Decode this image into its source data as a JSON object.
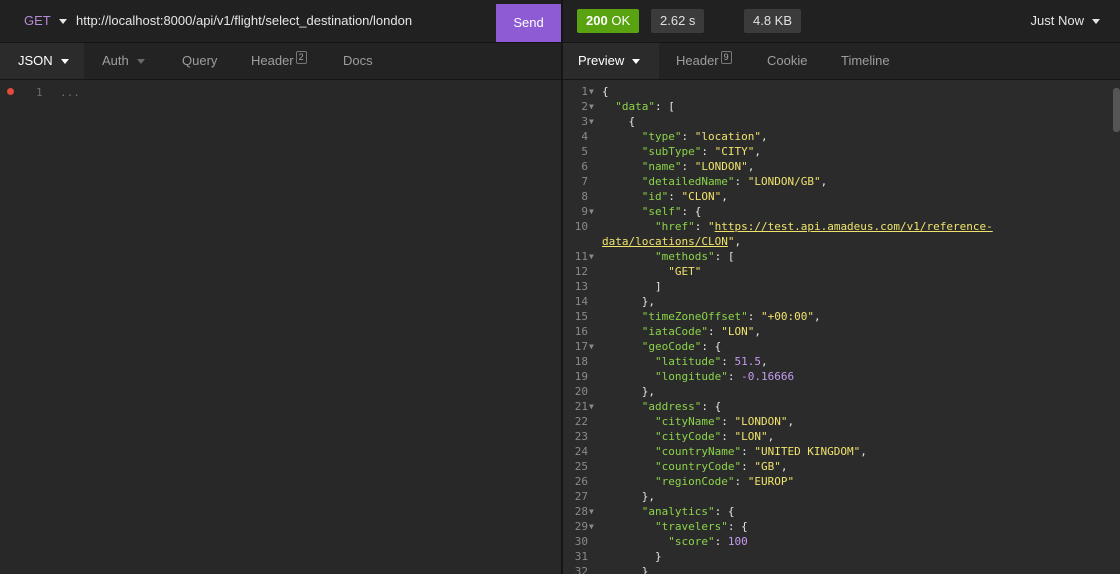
{
  "request": {
    "method": "GET",
    "url": "http://localhost:8000/api/v1/flight/select_destination/london",
    "send_label": "Send",
    "tabs": {
      "json": "JSON",
      "auth": "Auth",
      "query": "Query",
      "header": "Header",
      "header_count": "2",
      "docs": "Docs"
    },
    "editor": {
      "line_number": "1",
      "placeholder": "..."
    }
  },
  "response": {
    "status_code": "200",
    "status_text": "OK",
    "time": "2.62 s",
    "size": "4.8 KB",
    "history_label": "Just Now",
    "tabs": {
      "preview": "Preview",
      "header": "Header",
      "header_count": "9",
      "cookie": "Cookie",
      "timeline": "Timeline"
    },
    "gutter": [
      {
        "n": "1",
        "fold": true
      },
      {
        "n": "2",
        "fold": true
      },
      {
        "n": "3",
        "fold": true
      },
      {
        "n": "4"
      },
      {
        "n": "5"
      },
      {
        "n": "6"
      },
      {
        "n": "7"
      },
      {
        "n": "8"
      },
      {
        "n": "9",
        "fold": true
      },
      {
        "n": "10"
      },
      {
        "n": ""
      },
      {
        "n": "11",
        "fold": true
      },
      {
        "n": "12"
      },
      {
        "n": "13"
      },
      {
        "n": "14"
      },
      {
        "n": "15"
      },
      {
        "n": "16"
      },
      {
        "n": "17",
        "fold": true
      },
      {
        "n": "18"
      },
      {
        "n": "19"
      },
      {
        "n": "20"
      },
      {
        "n": "21",
        "fold": true
      },
      {
        "n": "22"
      },
      {
        "n": "23"
      },
      {
        "n": "24"
      },
      {
        "n": "25"
      },
      {
        "n": "26"
      },
      {
        "n": "27"
      },
      {
        "n": "28",
        "fold": true
      },
      {
        "n": "29",
        "fold": true
      },
      {
        "n": "30"
      },
      {
        "n": "31"
      },
      {
        "n": "32"
      }
    ],
    "lines": [
      [
        [
          "p",
          "{"
        ]
      ],
      [
        [
          "p",
          "  "
        ],
        [
          "k",
          "\"data\""
        ],
        [
          "p",
          ": ["
        ]
      ],
      [
        [
          "p",
          "    {"
        ]
      ],
      [
        [
          "p",
          "      "
        ],
        [
          "k",
          "\"type\""
        ],
        [
          "p",
          ": "
        ],
        [
          "s",
          "\"location\""
        ],
        [
          "p",
          ","
        ]
      ],
      [
        [
          "p",
          "      "
        ],
        [
          "k",
          "\"subType\""
        ],
        [
          "p",
          ": "
        ],
        [
          "s",
          "\"CITY\""
        ],
        [
          "p",
          ","
        ]
      ],
      [
        [
          "p",
          "      "
        ],
        [
          "k",
          "\"name\""
        ],
        [
          "p",
          ": "
        ],
        [
          "s",
          "\"LONDON\""
        ],
        [
          "p",
          ","
        ]
      ],
      [
        [
          "p",
          "      "
        ],
        [
          "k",
          "\"detailedName\""
        ],
        [
          "p",
          ": "
        ],
        [
          "s",
          "\"LONDON/GB\""
        ],
        [
          "p",
          ","
        ]
      ],
      [
        [
          "p",
          "      "
        ],
        [
          "k",
          "\"id\""
        ],
        [
          "p",
          ": "
        ],
        [
          "s",
          "\"CLON\""
        ],
        [
          "p",
          ","
        ]
      ],
      [
        [
          "p",
          "      "
        ],
        [
          "k",
          "\"self\""
        ],
        [
          "p",
          ": {"
        ]
      ],
      [
        [
          "p",
          "        "
        ],
        [
          "k",
          "\"href\""
        ],
        [
          "p",
          ": "
        ],
        [
          "s",
          "\""
        ],
        [
          "lk",
          "https://test.api.amadeus.com/v1/reference-"
        ]
      ],
      [
        [
          "lk",
          "data/locations/CLON"
        ],
        [
          "s",
          "\""
        ],
        [
          "p",
          ","
        ]
      ],
      [
        [
          "p",
          "        "
        ],
        [
          "k",
          "\"methods\""
        ],
        [
          "p",
          ": ["
        ]
      ],
      [
        [
          "p",
          "          "
        ],
        [
          "s",
          "\"GET\""
        ]
      ],
      [
        [
          "p",
          "        ]"
        ]
      ],
      [
        [
          "p",
          "      },"
        ]
      ],
      [
        [
          "p",
          "      "
        ],
        [
          "k",
          "\"timeZoneOffset\""
        ],
        [
          "p",
          ": "
        ],
        [
          "s",
          "\"+00:00\""
        ],
        [
          "p",
          ","
        ]
      ],
      [
        [
          "p",
          "      "
        ],
        [
          "k",
          "\"iataCode\""
        ],
        [
          "p",
          ": "
        ],
        [
          "s",
          "\"LON\""
        ],
        [
          "p",
          ","
        ]
      ],
      [
        [
          "p",
          "      "
        ],
        [
          "k",
          "\"geoCode\""
        ],
        [
          "p",
          ": {"
        ]
      ],
      [
        [
          "p",
          "        "
        ],
        [
          "k",
          "\"latitude\""
        ],
        [
          "p",
          ": "
        ],
        [
          "n",
          "51.5"
        ],
        [
          "p",
          ","
        ]
      ],
      [
        [
          "p",
          "        "
        ],
        [
          "k",
          "\"longitude\""
        ],
        [
          "p",
          ": "
        ],
        [
          "n",
          "-0.16666"
        ]
      ],
      [
        [
          "p",
          "      },"
        ]
      ],
      [
        [
          "p",
          "      "
        ],
        [
          "k",
          "\"address\""
        ],
        [
          "p",
          ": {"
        ]
      ],
      [
        [
          "p",
          "        "
        ],
        [
          "k",
          "\"cityName\""
        ],
        [
          "p",
          ": "
        ],
        [
          "s",
          "\"LONDON\""
        ],
        [
          "p",
          ","
        ]
      ],
      [
        [
          "p",
          "        "
        ],
        [
          "k",
          "\"cityCode\""
        ],
        [
          "p",
          ": "
        ],
        [
          "s",
          "\"LON\""
        ],
        [
          "p",
          ","
        ]
      ],
      [
        [
          "p",
          "        "
        ],
        [
          "k",
          "\"countryName\""
        ],
        [
          "p",
          ": "
        ],
        [
          "s",
          "\"UNITED KINGDOM\""
        ],
        [
          "p",
          ","
        ]
      ],
      [
        [
          "p",
          "        "
        ],
        [
          "k",
          "\"countryCode\""
        ],
        [
          "p",
          ": "
        ],
        [
          "s",
          "\"GB\""
        ],
        [
          "p",
          ","
        ]
      ],
      [
        [
          "p",
          "        "
        ],
        [
          "k",
          "\"regionCode\""
        ],
        [
          "p",
          ": "
        ],
        [
          "s",
          "\"EUROP\""
        ]
      ],
      [
        [
          "p",
          "      },"
        ]
      ],
      [
        [
          "p",
          "      "
        ],
        [
          "k",
          "\"analytics\""
        ],
        [
          "p",
          ": {"
        ]
      ],
      [
        [
          "p",
          "        "
        ],
        [
          "k",
          "\"travelers\""
        ],
        [
          "p",
          ": {"
        ]
      ],
      [
        [
          "p",
          "          "
        ],
        [
          "k",
          "\"score\""
        ],
        [
          "p",
          ": "
        ],
        [
          "n",
          "100"
        ]
      ],
      [
        [
          "p",
          "        }"
        ]
      ],
      [
        [
          "p",
          "      }"
        ]
      ]
    ]
  },
  "colors": {
    "send": "#8e5bd4",
    "status_ok": "#59a210",
    "key": "#8bd449",
    "string": "#f0e36c",
    "number": "#c69bf2",
    "method": "#b38bd6",
    "error_dot": "#e34a3b"
  },
  "icons": [
    "caret-down-icon",
    "error-dot-icon",
    "fold-arrow-icon"
  ]
}
